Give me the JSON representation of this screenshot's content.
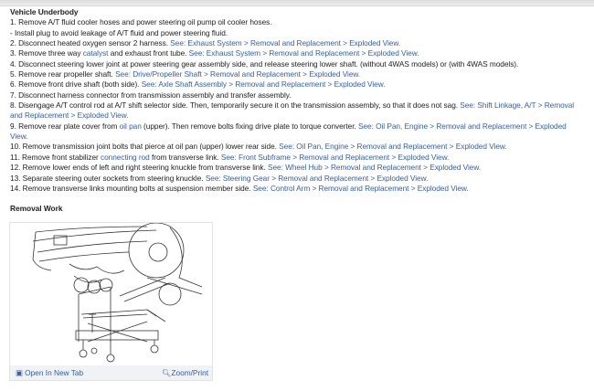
{
  "section_heading": "Vehicle Underbody",
  "steps": [
    [
      {
        "t": "1. Remove A/T fluid cooler hoses and power steering oil pump oil cooler hoses."
      }
    ],
    [
      {
        "t": "-  Install plug to avoid leakage of A/T fluid and power steering fluid."
      }
    ],
    [
      {
        "t": "2. Disconnect heated oxygen sensor 2 harness. "
      },
      {
        "t": "See: Exhaust System > Removal and Replacement > Exploded View.",
        "link": true
      }
    ],
    [
      {
        "t": "3. Remove three way "
      },
      {
        "t": "catalyst",
        "link": true
      },
      {
        "t": " and exhaust front tube. "
      },
      {
        "t": "See: Exhaust System > Removal and Replacement > Exploded View.",
        "link": true
      }
    ],
    [
      {
        "t": "4. Disconnect steering lower joint at power steering gear assembly side, and release steering lower shaft. (without 4WAS models) or (with 4WAS models)."
      }
    ],
    [
      {
        "t": "5. Remove rear propeller shaft. "
      },
      {
        "t": "See: Drive/Propeller Shaft > Removal and Replacement > Exploded View.",
        "link": true
      }
    ],
    [
      {
        "t": "6. Remove front drive shaft (both side). "
      },
      {
        "t": "See: Axle Shaft Assembly > Removal and Replacement > Exploded View.",
        "link": true
      }
    ],
    [
      {
        "t": "7. Disconnect harness connector from transmission assembly and transfer assembly."
      }
    ],
    [
      {
        "t": "8. Disengage A/T control rod at A/T shift selector side. Then, temporarily secure it on the transmission assembly, so that it does not sag. "
      },
      {
        "t": "See: Shift Linkage, A/T > Removal and Replacement > Exploded View.",
        "link": true
      }
    ],
    [
      {
        "t": "9. Remove rear plate cover from "
      },
      {
        "t": "oil pan",
        "link": true
      },
      {
        "t": " (upper). Then remove bolts fixing drive plate to torque converter. "
      },
      {
        "t": "See: Oil Pan, Engine > Removal and Replacement > Exploded View.",
        "link": true
      }
    ],
    [
      {
        "t": "10. Remove transmission joint bolts that pierce at oil pan (upper) lower rear side. "
      },
      {
        "t": "See: Oil Pan, Engine > Removal and Replacement > Exploded View.",
        "link": true
      }
    ],
    [
      {
        "t": "11. Remove front stabilizer "
      },
      {
        "t": "connecting rod",
        "link": true
      },
      {
        "t": " from transverse link. "
      },
      {
        "t": "See: Front Subframe > Removal and Replacement > Exploded View.",
        "link": true
      }
    ],
    [
      {
        "t": "12. Remove lower ends of left and right steering knuckle from transverse link. "
      },
      {
        "t": "See: Wheel Hub > Removal and Replacement > Exploded View.",
        "link": true
      }
    ],
    [
      {
        "t": "13. Separate steering outer sockets from steering knuckle. "
      },
      {
        "t": "See: Steering Gear > Removal and Replacement > Exploded View.",
        "link": true
      }
    ],
    [
      {
        "t": "14. Remove transverse links mounting bolts at suspension member side. "
      },
      {
        "t": "See: Control Arm > Removal and Replacement > Exploded View.",
        "link": true
      }
    ]
  ],
  "removal_heading": "Removal Work",
  "figure": {
    "open_label": "Open In New Tab",
    "open_icon": "open-new-tab-icon",
    "zoom_label": "Zoom/Print",
    "zoom_icon": "magnifier-icon"
  },
  "colors": {
    "link": "#2f5fae",
    "text": "#222222",
    "footer_bg": "#f0f2f5"
  }
}
